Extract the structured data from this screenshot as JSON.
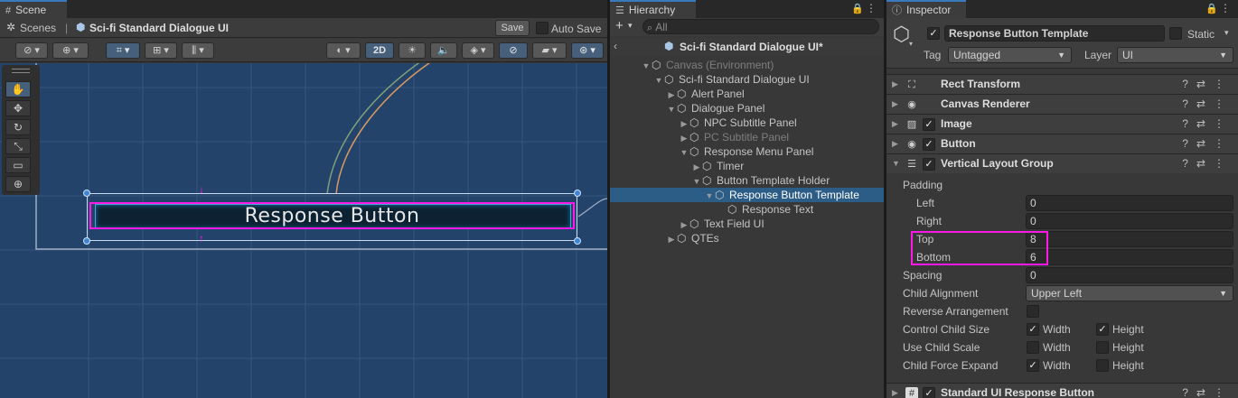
{
  "scene": {
    "tab": "Scene",
    "breadcrumb_root": "Scenes",
    "breadcrumb_scene": "Sci-fi Standard Dialogue UI",
    "save_label": "Save",
    "auto_save_label": "Auto Save",
    "mode_2d": "2D",
    "canvas_button_text": "Response Button",
    "tools": [
      {
        "icon": "hand-tool-icon",
        "glyph": "✋"
      },
      {
        "icon": "move-tool-icon",
        "glyph": "✥"
      },
      {
        "icon": "rotate-tool-icon",
        "glyph": "↻"
      },
      {
        "icon": "scale-tool-icon",
        "glyph": "⤡"
      },
      {
        "icon": "rect-tool-icon",
        "glyph": "▭"
      },
      {
        "icon": "transform-tool-icon",
        "glyph": "⊕"
      }
    ]
  },
  "hierarchy": {
    "tab": "Hierarchy",
    "search_placeholder": "All",
    "root": "Sci-fi Standard Dialogue UI*",
    "items": [
      {
        "label": "Canvas (Environment)",
        "depth": 1,
        "arrow": "▼",
        "dim": true
      },
      {
        "label": "Sci-fi Standard Dialogue UI",
        "depth": 2,
        "arrow": "▼",
        "dim": false
      },
      {
        "label": "Alert Panel",
        "depth": 3,
        "arrow": "▶",
        "dim": false
      },
      {
        "label": "Dialogue Panel",
        "depth": 3,
        "arrow": "▼",
        "dim": false
      },
      {
        "label": "NPC Subtitle Panel",
        "depth": 4,
        "arrow": "▶",
        "dim": false
      },
      {
        "label": "PC Subtitle Panel",
        "depth": 4,
        "arrow": "▶",
        "dim": true
      },
      {
        "label": "Response Menu Panel",
        "depth": 4,
        "arrow": "▼",
        "dim": false
      },
      {
        "label": "Timer",
        "depth": 5,
        "arrow": "▶",
        "dim": false
      },
      {
        "label": "Button Template Holder",
        "depth": 5,
        "arrow": "▼",
        "dim": false
      },
      {
        "label": "Response Button Template",
        "depth": 6,
        "arrow": "▼",
        "dim": false,
        "selected": true
      },
      {
        "label": "Response Text",
        "depth": 7,
        "arrow": "",
        "dim": false
      },
      {
        "label": "Text Field UI",
        "depth": 4,
        "arrow": "▶",
        "dim": false
      },
      {
        "label": "QTEs",
        "depth": 3,
        "arrow": "▶",
        "dim": false
      }
    ]
  },
  "inspector": {
    "tab": "Inspector",
    "object_name": "Response Button Template",
    "static_label": "Static",
    "tag_label": "Tag",
    "tag_value": "Untagged",
    "layer_label": "Layer",
    "layer_value": "UI",
    "components": [
      {
        "name": "Rect Transform",
        "icon": "rect-transform-icon",
        "glyph": "⛶",
        "checkbox": false,
        "arrow": "▶"
      },
      {
        "name": "Canvas Renderer",
        "icon": "eye-icon",
        "glyph": "◉",
        "checkbox": false,
        "arrow": "▶"
      },
      {
        "name": "Image",
        "icon": "image-icon",
        "glyph": "▨",
        "checkbox": true,
        "arrow": "▶"
      },
      {
        "name": "Button",
        "icon": "button-icon",
        "glyph": "◉",
        "checkbox": true,
        "arrow": "▶"
      },
      {
        "name": "Vertical Layout Group",
        "icon": "layout-icon",
        "glyph": "☰",
        "checkbox": true,
        "arrow": "▼"
      }
    ],
    "padding_label": "Padding",
    "padding": [
      {
        "label": "Left",
        "value": "0"
      },
      {
        "label": "Right",
        "value": "0"
      },
      {
        "label": "Top",
        "value": "8"
      },
      {
        "label": "Bottom",
        "value": "6"
      }
    ],
    "spacing_label": "Spacing",
    "spacing_value": "0",
    "child_alignment_label": "Child Alignment",
    "child_alignment_value": "Upper Left",
    "reverse_label": "Reverse Arrangement",
    "control_size_label": "Control Child Size",
    "use_scale_label": "Use Child Scale",
    "force_expand_label": "Child Force Expand",
    "width_label": "Width",
    "height_label": "Height",
    "control_size": {
      "width": true,
      "height": true
    },
    "use_scale": {
      "width": false,
      "height": false
    },
    "force_expand": {
      "width": true,
      "height": false
    },
    "footer_component": "Standard UI Response Button",
    "footer_icon": "script-icon",
    "highlight_color": "#ff19e6",
    "selection_color": "#2c5d87"
  }
}
